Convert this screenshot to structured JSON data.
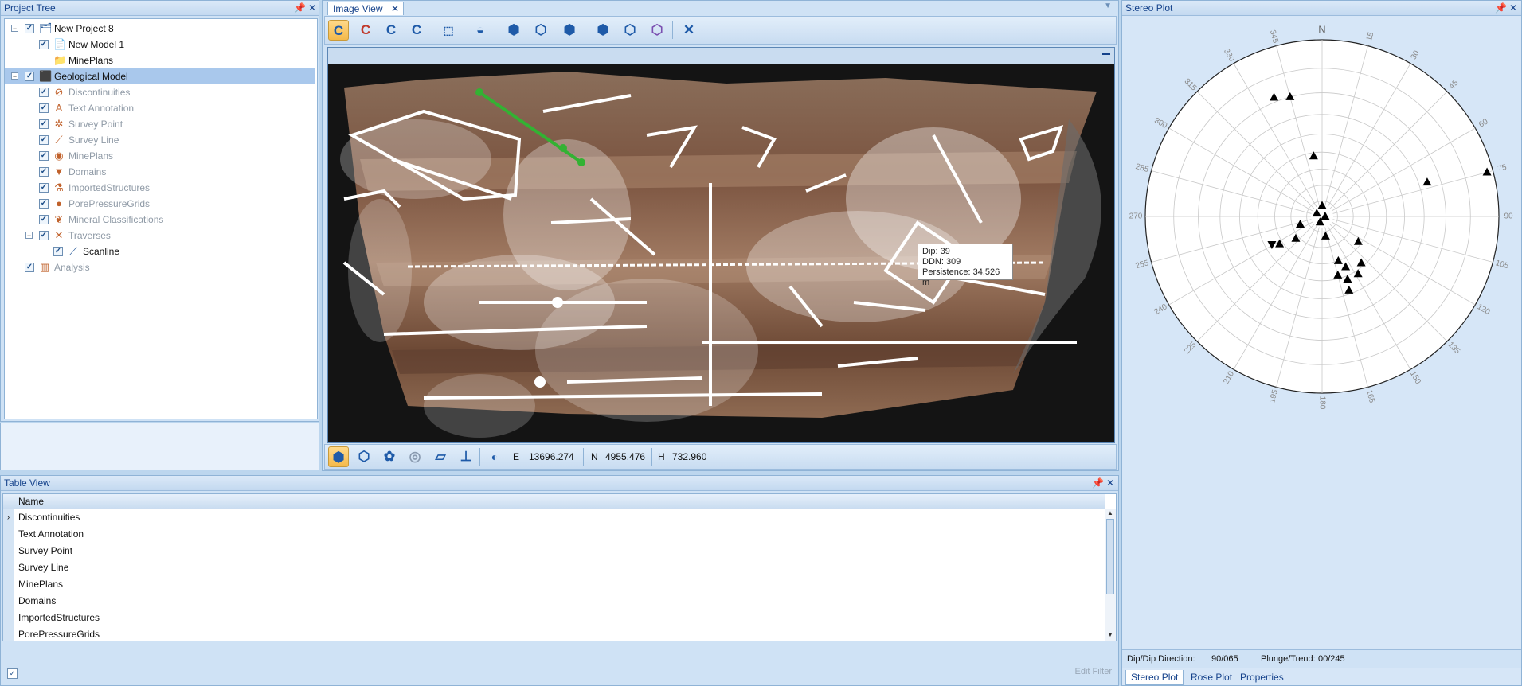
{
  "project_tree": {
    "title": "Project Tree",
    "items": [
      {
        "label": "New Project 8",
        "indent": 0,
        "expand": "−",
        "icon": "🗂",
        "gray": false
      },
      {
        "label": "New Model 1",
        "indent": 1,
        "expand": "",
        "icon": "📄",
        "gray": false
      },
      {
        "label": "MinePlans",
        "indent": 1,
        "expand": "",
        "icon": "📁",
        "gray": false,
        "nocheck": true
      },
      {
        "label": "Geological Model",
        "indent": 0,
        "expand": "−",
        "icon": "⬛",
        "gray": false,
        "selected": true
      },
      {
        "label": "Discontinuities",
        "indent": 1,
        "expand": "",
        "icon": "⊘",
        "gray": true
      },
      {
        "label": "Text Annotation",
        "indent": 1,
        "expand": "",
        "icon": "A",
        "gray": true
      },
      {
        "label": "Survey Point",
        "indent": 1,
        "expand": "",
        "icon": "✲",
        "gray": true
      },
      {
        "label": "Survey Line",
        "indent": 1,
        "expand": "",
        "icon": "⟋",
        "gray": true
      },
      {
        "label": "MinePlans",
        "indent": 1,
        "expand": "",
        "icon": "◉",
        "gray": true
      },
      {
        "label": "Domains",
        "indent": 1,
        "expand": "",
        "icon": "▼",
        "gray": true
      },
      {
        "label": "ImportedStructures",
        "indent": 1,
        "expand": "",
        "icon": "⚗",
        "gray": true
      },
      {
        "label": "PorePressureGrids",
        "indent": 1,
        "expand": "",
        "icon": "●",
        "gray": true
      },
      {
        "label": "Mineral Classifications",
        "indent": 1,
        "expand": "",
        "icon": "❦",
        "gray": true
      },
      {
        "label": "Traverses",
        "indent": 1,
        "expand": "−",
        "icon": "✕",
        "gray": true
      },
      {
        "label": "Scanline",
        "indent": 2,
        "expand": "",
        "icon": "⟋",
        "gray": false
      },
      {
        "label": "Analysis",
        "indent": 0,
        "expand": "",
        "icon": "▥",
        "gray": true
      }
    ]
  },
  "image_view": {
    "tab_label": "Image View",
    "tooltip": {
      "dip": "Dip: 39",
      "ddn": "DDN: 309",
      "persistence": "Persistence: 34.526 m"
    },
    "coords": {
      "e_label": "E",
      "e_value": "13696.274",
      "n_label": "N",
      "n_value": "4955.476",
      "h_label": "H",
      "h_value": "732.960"
    }
  },
  "table_view": {
    "title": "Table View",
    "column_header": "Name",
    "rows": [
      "Discontinuities",
      "Text Annotation",
      "Survey Point",
      "Survey Line",
      "MinePlans",
      "Domains",
      "ImportedStructures",
      "PorePressureGrids"
    ],
    "edit_filter": "Edit Filter"
  },
  "stereo_plot": {
    "title": "Stereo Plot",
    "north_label": "N",
    "azimuth_labels": [
      "15",
      "30",
      "45",
      "60",
      "75",
      "90",
      "105",
      "120",
      "135",
      "150",
      "165",
      "180",
      "195",
      "210",
      "225",
      "240",
      "255",
      "270",
      "285",
      "300",
      "315",
      "330",
      "345"
    ],
    "poles": [
      {
        "trend": 345,
        "plunge": 20,
        "dir": "up"
      },
      {
        "trend": 338,
        "plunge": 18,
        "dir": "up"
      },
      {
        "trend": 352,
        "plunge": 52,
        "dir": "up"
      },
      {
        "trend": 75,
        "plunge": 2,
        "dir": "up"
      },
      {
        "trend": 72,
        "plunge": 26,
        "dir": "up"
      },
      {
        "trend": 0,
        "plunge": 83,
        "dir": "up"
      },
      {
        "trend": 300,
        "plunge": 86,
        "dir": "up"
      },
      {
        "trend": 90,
        "plunge": 88,
        "dir": "up"
      },
      {
        "trend": 200,
        "plunge": 86,
        "dir": "up"
      },
      {
        "trend": 250,
        "plunge": 75,
        "dir": "up"
      },
      {
        "trend": 230,
        "plunge": 68,
        "dir": "up"
      },
      {
        "trend": 237,
        "plunge": 58,
        "dir": "up"
      },
      {
        "trend": 241,
        "plunge": 54,
        "dir": "down"
      },
      {
        "trend": 170,
        "plunge": 77,
        "dir": "up"
      },
      {
        "trend": 125,
        "plunge": 62,
        "dir": "up"
      },
      {
        "trend": 160,
        "plunge": 60,
        "dir": "up"
      },
      {
        "trend": 155,
        "plunge": 55,
        "dir": "up"
      },
      {
        "trend": 165,
        "plunge": 52,
        "dir": "up"
      },
      {
        "trend": 158,
        "plunge": 48,
        "dir": "up"
      },
      {
        "trend": 148,
        "plunge": 48,
        "dir": "up"
      },
      {
        "trend": 140,
        "plunge": 52,
        "dir": "up"
      },
      {
        "trend": 160,
        "plunge": 42,
        "dir": "up"
      }
    ],
    "status": {
      "dip_label": "Dip/Dip Direction:",
      "dip_value": "90/065",
      "plunge_label": "Plunge/Trend:",
      "plunge_value": "00/245"
    },
    "tabs": [
      "Stereo Plot",
      "Rose Plot",
      "Properties"
    ]
  }
}
